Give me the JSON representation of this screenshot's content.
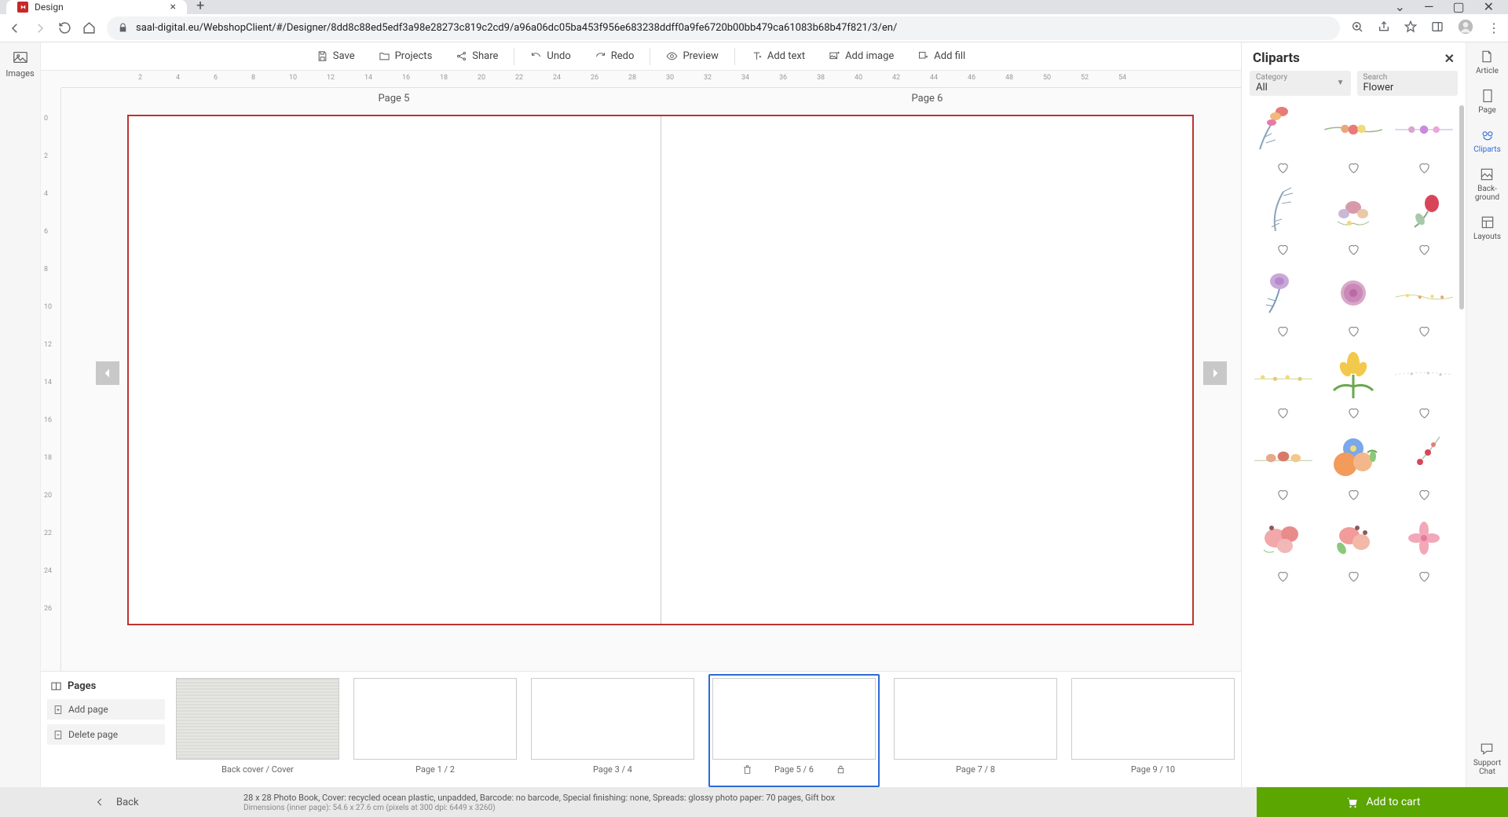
{
  "browser": {
    "tab_title": "Design",
    "url": "saal-digital.eu/WebshopClient/#/Designer/8dd8c88ed5edf3a98e28273c819c2cd9/a96a06dc05ba453f956e683238ddff0a9fe6720b00bb479ca61083b68b47f821/3/en/"
  },
  "left_rail": {
    "images": "Images"
  },
  "toolbar": {
    "save": "Save",
    "projects": "Projects",
    "share": "Share",
    "undo": "Undo",
    "redo": "Redo",
    "preview": "Preview",
    "add_text": "Add text",
    "add_image": "Add image",
    "add_fill": "Add fill"
  },
  "canvas": {
    "page_left": "Page 5",
    "page_right": "Page 6",
    "ruler_h": [
      "2",
      "4",
      "6",
      "8",
      "10",
      "12",
      "14",
      "16",
      "18",
      "20",
      "22",
      "24",
      "26",
      "28",
      "30",
      "32",
      "34",
      "36",
      "38",
      "40",
      "42",
      "44",
      "46",
      "48",
      "50",
      "52",
      "54"
    ],
    "ruler_v": [
      "0",
      "2",
      "4",
      "6",
      "8",
      "10",
      "12",
      "14",
      "16",
      "18",
      "20",
      "22",
      "24",
      "26"
    ]
  },
  "pages": {
    "title": "Pages",
    "add": "Add page",
    "delete": "Delete page",
    "thumbs": [
      {
        "label": "Back cover / Cover",
        "selected": false,
        "cover": true
      },
      {
        "label": "Page 1 / 2",
        "selected": false
      },
      {
        "label": "Page 3 / 4",
        "selected": false
      },
      {
        "label": "Page 5 / 6",
        "selected": true
      },
      {
        "label": "Page 7 / 8",
        "selected": false
      },
      {
        "label": "Page 9 / 10",
        "selected": false
      }
    ]
  },
  "cliparts": {
    "title": "Cliparts",
    "category_label": "Category",
    "category_value": "All",
    "search_label": "Search",
    "search_value": "Flower"
  },
  "right_rail": {
    "article": "Article",
    "page": "Page",
    "cliparts": "Cliparts",
    "background": "Back-\nground",
    "layouts": "Layouts",
    "support": "Support\nChat"
  },
  "footer": {
    "back": "Back",
    "info1": "28 x 28 Photo Book, Cover: recycled ocean plastic, unpadded, Barcode: no barcode, Special finishing: none, Spreads: glossy photo paper: 70 pages, Gift box",
    "info2": "Dimensions (inner page): 54.6 x 27.6 cm (pixels at 300 dpi: 6449 x 3260)",
    "cart": "Add to cart"
  }
}
